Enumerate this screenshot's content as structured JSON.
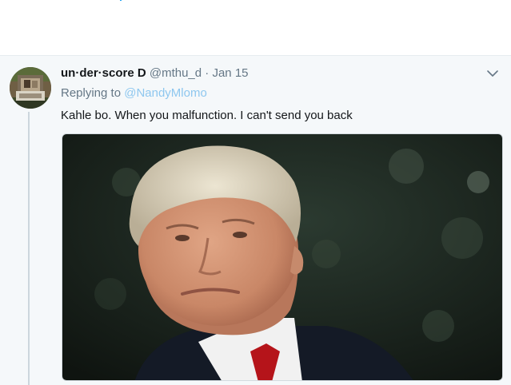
{
  "tweet": {
    "display_name": "un·der·score D",
    "handle": "@mthu_d",
    "separator": "·",
    "date": "Jan 15",
    "replying_prefix": "Replying to",
    "replying_to": "@NandyMlomo",
    "text": "Kahle bo. When you malfunction. I can't send you back"
  },
  "icons": {
    "avatar": "avatar",
    "menu": "chevron-down-icon"
  },
  "colors": {
    "name": "#14171a",
    "meta": "#657786",
    "link": "#8ec7ef",
    "background": "#f5f8fa"
  }
}
